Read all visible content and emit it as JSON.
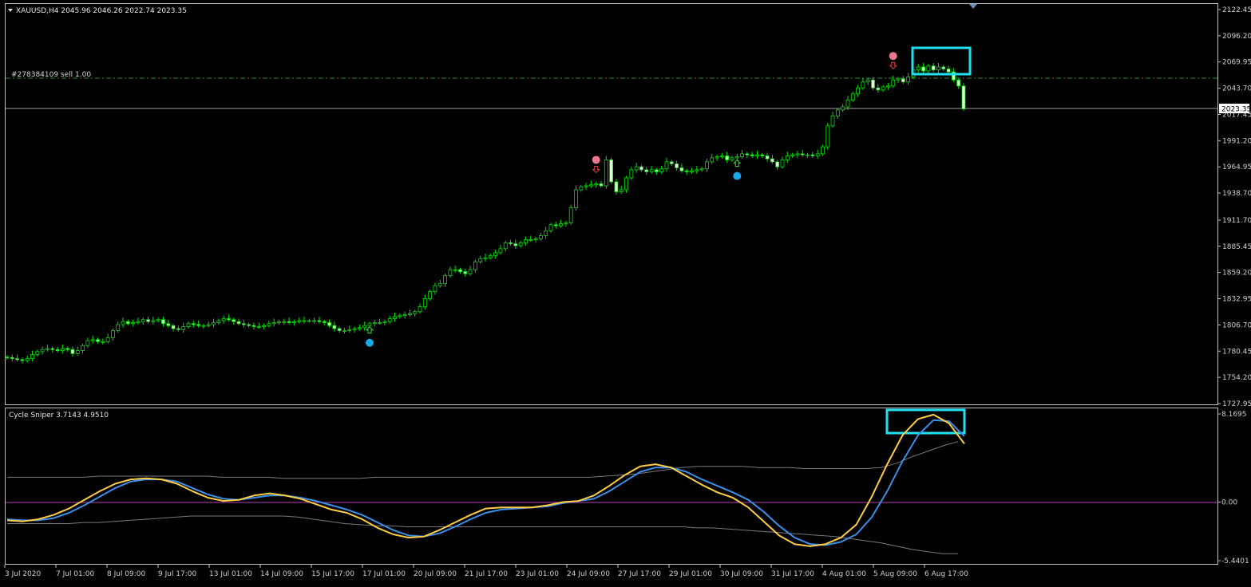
{
  "window": {
    "symbol_info": "XAUUSD,H4  2045.96 2046.26 2022.74 2023.35",
    "order_line_label": "#278384109 sell 1.00",
    "current_price_label": "2023.35",
    "indicator_label": "Cycle Sniper 3.7143 4.9510",
    "dropdown_icon": "triangle-down-icon"
  },
  "colors": {
    "background": "#000000",
    "grid_frame": "#c0c0c0",
    "candle_green": "#00e000",
    "candle_body_up": "#000000",
    "candle_body_down": "#d8ffd0",
    "order_line": "#2e8b2e",
    "price_line": "#a0a0a0",
    "highlight_box": "#22e0f0",
    "sell_signal": "#e87890",
    "buy_signal": "#19a8e8",
    "osc_yellow": "#ffcc44",
    "osc_blue": "#3a8fe8",
    "osc_band": "#8a8a8a",
    "zero_line": "#b040b0"
  },
  "price_axis": {
    "ticks": [
      "2122.45",
      "2096.20",
      "2069.95",
      "2043.70",
      "2017.45",
      "1991.20",
      "1964.95",
      "1938.70",
      "1911.70",
      "1885.45",
      "1859.20",
      "1832.95",
      "1806.70",
      "1780.45",
      "1754.20",
      "1727.95"
    ]
  },
  "indicator_axis": {
    "ticks": [
      "8.1695",
      "0.00",
      "-5.4401"
    ]
  },
  "time_axis": {
    "labels": [
      "3 Jul 2020",
      "7 Jul 01:00",
      "8 Jul 09:00",
      "9 Jul 17:00",
      "13 Jul 01:00",
      "14 Jul 09:00",
      "15 Jul 17:00",
      "17 Jul 01:00",
      "20 Jul 09:00",
      "21 Jul 17:00",
      "23 Jul 01:00",
      "24 Jul 09:00",
      "27 Jul 17:00",
      "29 Jul 01:00",
      "30 Jul 09:00",
      "31 Jul 17:00",
      "4 Aug 01:00",
      "5 Aug 09:00",
      "6 Aug 17:00"
    ]
  },
  "chart_data": {
    "type": "candlestick",
    "symbol": "XAUUSD",
    "timeframe": "H4",
    "ohlc_last": {
      "open": 2045.96,
      "high": 2046.26,
      "low": 2022.74,
      "close": 2023.35
    },
    "price_range": [
      1727.95,
      2122.45
    ],
    "closes": [
      1774,
      1773,
      1772,
      1771,
      1773,
      1777,
      1780,
      1782,
      1783,
      1782,
      1781,
      1783,
      1782,
      1778,
      1781,
      1786,
      1791,
      1792,
      1790,
      1790,
      1794,
      1801,
      1807,
      1810,
      1808,
      1809,
      1810,
      1812,
      1810,
      1811,
      1812,
      1808,
      1806,
      1803,
      1802,
      1805,
      1808,
      1807,
      1806,
      1806,
      1807,
      1809,
      1811,
      1813,
      1812,
      1810,
      1808,
      1807,
      1806,
      1805,
      1805,
      1806,
      1808,
      1809,
      1810,
      1810,
      1809,
      1810,
      1811,
      1811,
      1811,
      1811,
      1810,
      1809,
      1806,
      1803,
      1801,
      1801,
      1802,
      1803,
      1804,
      1806,
      1808,
      1809,
      1809,
      1810,
      1813,
      1815,
      1816,
      1817,
      1818,
      1820,
      1825,
      1833,
      1840,
      1846,
      1848,
      1856,
      1862,
      1862,
      1860,
      1858,
      1862,
      1870,
      1873,
      1874,
      1876,
      1879,
      1883,
      1889,
      1888,
      1886,
      1889,
      1892,
      1892,
      1893,
      1896,
      1901,
      1907,
      1906,
      1908,
      1909,
      1924,
      1942,
      1945,
      1946,
      1947,
      1948,
      1946,
      1972,
      1950,
      1940,
      1942,
      1954,
      1962,
      1965,
      1962,
      1960,
      1962,
      1960,
      1963,
      1970,
      1968,
      1964,
      1961,
      1960,
      1961,
      1962,
      1963,
      1970,
      1974,
      1975,
      1976,
      1972,
      1974,
      1975,
      1978,
      1977,
      1976,
      1977,
      1976,
      1973,
      1970,
      1965,
      1972,
      1976,
      1977,
      1978,
      1977,
      1977,
      1976,
      1978,
      1985,
      2006,
      2016,
      2022,
      2025,
      2032,
      2038,
      2044,
      2050,
      2052,
      2044,
      2042,
      2045,
      2046,
      2052,
      2053,
      2050,
      2055,
      2062,
      2065,
      2061,
      2066,
      2062,
      2065,
      2063,
      2060,
      2052,
      2046,
      2023
    ],
    "order_line_price": 2052.0,
    "current_price": 2023.35,
    "sell_arrows_at_candle": [
      117,
      176
    ],
    "buy_arrows_at_candle": [
      72,
      145
    ],
    "indicator": {
      "name": "Cycle Sniper",
      "values_label": [
        3.7143,
        4.951
      ],
      "range": [
        -5.4401,
        8.1695
      ],
      "fast_line": [
        -1.7,
        -1.8,
        -1.6,
        -1.2,
        -0.6,
        0.2,
        1.0,
        1.7,
        2.1,
        2.2,
        2.1,
        1.7,
        1.0,
        0.4,
        0.1,
        0.2,
        0.6,
        0.8,
        0.6,
        0.3,
        -0.2,
        -0.7,
        -1.0,
        -1.6,
        -2.4,
        -3.0,
        -3.3,
        -3.2,
        -2.6,
        -1.9,
        -1.2,
        -0.6,
        -0.5,
        -0.5,
        -0.5,
        -0.3,
        0.0,
        0.1,
        0.6,
        1.5,
        2.5,
        3.3,
        3.5,
        3.2,
        2.4,
        1.6,
        0.9,
        0.4,
        -0.5,
        -1.8,
        -3.1,
        -3.9,
        -4.1,
        -3.9,
        -3.3,
        -2.1,
        0.5,
        3.5,
        6.2,
        7.7,
        8.1,
        7.3,
        5.4
      ],
      "slow_line": [
        -1.6,
        -1.7,
        -1.7,
        -1.5,
        -1.0,
        -0.3,
        0.5,
        1.3,
        1.9,
        2.1,
        2.1,
        1.9,
        1.3,
        0.7,
        0.3,
        0.2,
        0.4,
        0.6,
        0.6,
        0.4,
        0.1,
        -0.3,
        -0.7,
        -1.2,
        -1.9,
        -2.6,
        -3.1,
        -3.2,
        -2.9,
        -2.3,
        -1.6,
        -1.0,
        -0.7,
        -0.6,
        -0.5,
        -0.4,
        -0.1,
        0.1,
        0.3,
        1.0,
        1.9,
        2.8,
        3.2,
        3.2,
        2.8,
        2.1,
        1.5,
        0.9,
        0.2,
        -0.9,
        -2.2,
        -3.3,
        -3.9,
        -4.0,
        -3.7,
        -3.0,
        -1.4,
        1.0,
        3.8,
        6.2,
        7.6,
        7.5,
        6.1
      ],
      "upper_band": [
        2.3,
        2.3,
        2.3,
        2.3,
        2.3,
        2.3,
        2.4,
        2.4,
        2.4,
        2.4,
        2.4,
        2.4,
        2.4,
        2.4,
        2.3,
        2.3,
        2.3,
        2.3,
        2.2,
        2.2,
        2.2,
        2.2,
        2.2,
        2.2,
        2.3,
        2.3,
        2.3,
        2.3,
        2.3,
        2.3,
        2.3,
        2.3,
        2.3,
        2.3,
        2.3,
        2.3,
        2.3,
        2.3,
        2.3,
        2.4,
        2.5,
        2.6,
        2.8,
        3.0,
        3.2,
        3.3,
        3.3,
        3.3,
        3.3,
        3.2,
        3.2,
        3.2,
        3.1,
        3.1,
        3.1,
        3.1,
        3.1,
        3.2,
        3.6,
        4.2,
        4.7,
        5.2,
        5.6
      ],
      "lower_band": [
        -2.0,
        -2.0,
        -2.0,
        -2.0,
        -2.0,
        -1.9,
        -1.9,
        -1.8,
        -1.7,
        -1.6,
        -1.5,
        -1.4,
        -1.3,
        -1.3,
        -1.3,
        -1.3,
        -1.3,
        -1.3,
        -1.3,
        -1.4,
        -1.6,
        -1.8,
        -2.0,
        -2.1,
        -2.2,
        -2.2,
        -2.3,
        -2.3,
        -2.3,
        -2.3,
        -2.3,
        -2.3,
        -2.3,
        -2.3,
        -2.3,
        -2.3,
        -2.3,
        -2.3,
        -2.3,
        -2.3,
        -2.3,
        -2.3,
        -2.3,
        -2.3,
        -2.3,
        -2.4,
        -2.4,
        -2.5,
        -2.6,
        -2.7,
        -2.8,
        -2.9,
        -3.0,
        -3.1,
        -3.2,
        -3.4,
        -3.6,
        -3.8,
        -4.1,
        -4.4,
        -4.6,
        -4.8,
        -4.8
      ]
    }
  }
}
